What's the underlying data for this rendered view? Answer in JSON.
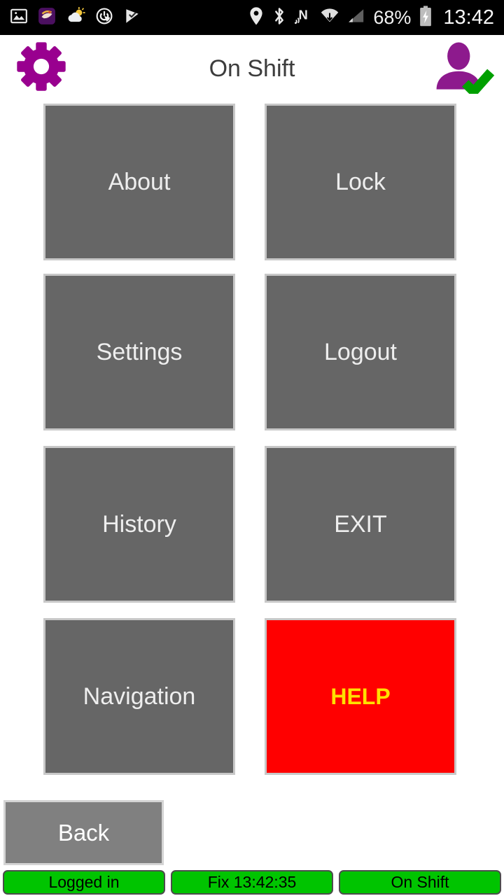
{
  "status_bar": {
    "left_icons": [
      {
        "name": "screenshot-image-icon"
      },
      {
        "name": "app-notification-icon"
      },
      {
        "name": "weather-partly-cloudy-icon"
      },
      {
        "name": "power-timer-icon"
      },
      {
        "name": "checkmark-flag-icon"
      }
    ],
    "right_icons": [
      {
        "name": "location-pin-icon"
      },
      {
        "name": "bluetooth-icon"
      },
      {
        "name": "nfc-icon"
      },
      {
        "name": "wifi-icon"
      },
      {
        "name": "cellular-signal-icon"
      }
    ],
    "battery_percent": "68%",
    "battery_icon": "battery-charging-icon",
    "clock": "13:42"
  },
  "header": {
    "title": "On Shift",
    "settings_icon": "gear-icon",
    "user_icon": "user-checked-icon",
    "gear_color": "#99008f",
    "user_color": "#8d1a8d",
    "check_color": "#00a000"
  },
  "grid": {
    "tiles": [
      {
        "label": "About",
        "name": "tile-about",
        "col": "col-left",
        "row": "row-1",
        "style": "normal"
      },
      {
        "label": "Lock",
        "name": "tile-lock",
        "col": "col-right",
        "row": "row-1",
        "style": "normal"
      },
      {
        "label": "Settings",
        "name": "tile-settings",
        "col": "col-left",
        "row": "row-2",
        "style": "normal"
      },
      {
        "label": "Logout",
        "name": "tile-logout",
        "col": "col-right",
        "row": "row-2",
        "style": "normal"
      },
      {
        "label": "History",
        "name": "tile-history",
        "col": "col-left",
        "row": "row-3",
        "style": "normal"
      },
      {
        "label": "EXIT",
        "name": "tile-exit",
        "col": "col-right",
        "row": "row-3",
        "style": "normal"
      },
      {
        "label": "Navigation",
        "name": "tile-navigation",
        "col": "col-left",
        "row": "row-4",
        "style": "normal"
      },
      {
        "label": "HELP",
        "name": "tile-help",
        "col": "col-right",
        "row": "row-4",
        "style": "danger"
      }
    ],
    "tile_color": "#666666",
    "tile_border_color": "#c8c8c8",
    "tile_text_color": "#eeeeee",
    "help_bg_color": "#ff0000",
    "help_text_color": "#ffe000"
  },
  "back_button": {
    "label": "Back",
    "bg_color": "#808080"
  },
  "status_footer": {
    "chip_color": "#00c400",
    "chips": [
      {
        "label": "Logged in",
        "name": "status-chip-login"
      },
      {
        "label": "Fix 13:42:35",
        "name": "status-chip-gps-fix"
      },
      {
        "label": "On Shift",
        "name": "status-chip-shift"
      }
    ]
  }
}
